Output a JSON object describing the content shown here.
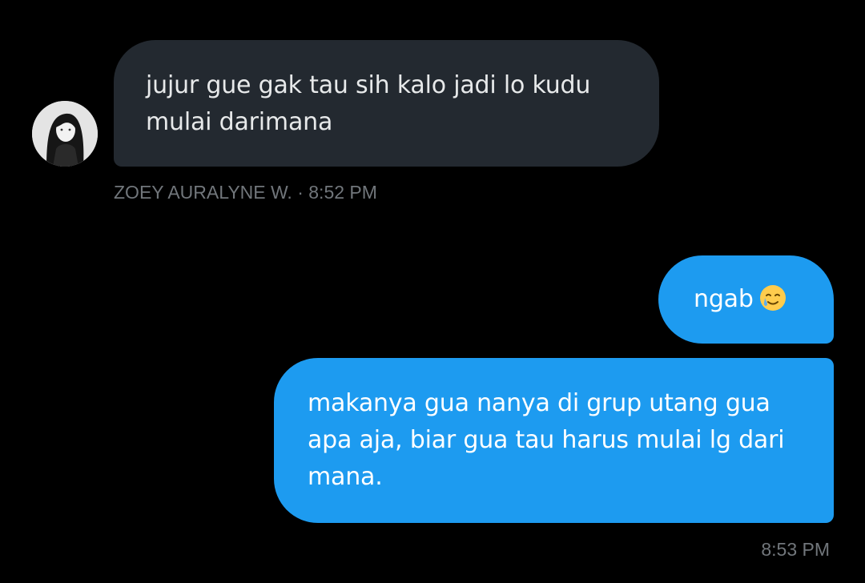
{
  "conversation": {
    "messages": [
      {
        "direction": "incoming",
        "text": "jujur gue gak tau sih kalo jadi lo kudu mulai darimana",
        "meta": "ZOEY AURALYNE W. · 8:52 PM"
      },
      {
        "direction": "outgoing",
        "text": "ngab",
        "emoji": "smiling-face-with-tear-icon"
      },
      {
        "direction": "outgoing",
        "text": "makanya gua nanya di grup utang gua apa aja, biar gua tau harus mulai lg dari mana.",
        "meta": "8:53 PM"
      }
    ]
  },
  "colors": {
    "background": "#000000",
    "incoming_bubble": "#232930",
    "outgoing_bubble": "#1d9bf0",
    "meta_text": "#71767b"
  }
}
